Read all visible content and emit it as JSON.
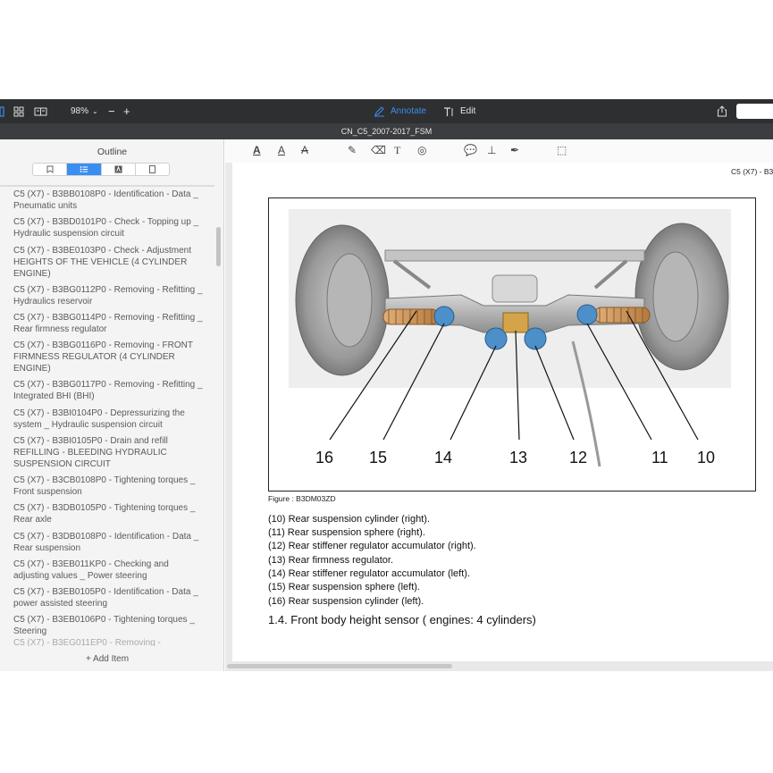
{
  "toolbar": {
    "zoom": "98%",
    "zoom_out": "−",
    "zoom_in": "+",
    "annotate_label": "Annotate",
    "edit_label": "Edit",
    "accent_color": "#3b8ef0"
  },
  "window": {
    "title": "CN_C5_2007-2017_FSM"
  },
  "sidebar": {
    "title": "Outline",
    "tabs": [
      {
        "icon": "bookmark-icon",
        "active": false
      },
      {
        "icon": "outline-list-icon",
        "active": true
      },
      {
        "icon": "annotations-icon",
        "active": false
      },
      {
        "icon": "page-icon",
        "active": false
      }
    ],
    "items": [
      {
        "label": "C5 (X7) - B3BB0108P0 - Identification - Data _ Pneumatic units"
      },
      {
        "label": "C5 (X7) - B3BD0101P0 - Check - Topping up _ Hydraulic suspension circuit"
      },
      {
        "label": "C5 (X7) - B3BE0103P0 - Check - Adjustment HEIGHTS OF THE VEHICLE (4 CYLINDER ENGINE)"
      },
      {
        "label": "C5 (X7) - B3BG0112P0 - Removing - Refitting _ Hydraulics reservoir"
      },
      {
        "label": "C5 (X7) - B3BG0114P0 - Removing - Refitting _ Rear firmness regulator"
      },
      {
        "label": "C5 (X7) - B3BG0116P0 - Removing - FRONT FIRMNESS REGULATOR (4 CYLINDER ENGINE)"
      },
      {
        "label": "C5 (X7) - B3BG0117P0 - Removing - Refitting _ Integrated BHI (BHI)"
      },
      {
        "label": "C5 (X7) - B3BI0104P0 - Depressurizing the system _ Hydraulic suspension circuit"
      },
      {
        "label": "C5 (X7) - B3BI0105P0 - Drain and refill REFILLING - BLEEDING HYDRAULIC SUSPENSION CIRCUIT"
      },
      {
        "label": "C5 (X7) - B3CB0108P0 - Tightening torques _ Front suspension"
      },
      {
        "label": "C5 (X7) - B3DB0105P0 - Tightening torques _ Rear axle"
      },
      {
        "label": "C5 (X7) - B3DB0108P0 - Identification - Data _ Rear suspension"
      },
      {
        "label": "C5 (X7) - B3EB011KP0 - Checking and adjusting values _ Power steering"
      },
      {
        "label": "C5 (X7) - B3EB0105P0 - Identification - Data _ power assisted steering"
      },
      {
        "label": "C5 (X7) - B3EB0106P0 - Tightening torques _ Steering"
      },
      {
        "label": "C5 (X7) - B3EG011EP0 - Removing -"
      }
    ],
    "add_item": "+ Add Item"
  },
  "document": {
    "page_header": "C5 (X7) - B3",
    "figure_callouts": [
      "16",
      "15",
      "14",
      "13",
      "12",
      "11",
      "10"
    ],
    "figure_caption": "Figure : B3DM03ZD",
    "legend": [
      "(10) Rear suspension cylinder (right).",
      "(11) Rear suspension sphere (right).",
      "(12) Rear stiffener regulator accumulator (right).",
      "(13) Rear firmness regulator.",
      "(14) Rear stiffener regulator accumulator (left).",
      "(15) Rear suspension sphere (left).",
      "(16) Rear suspension cylinder (left)."
    ],
    "section_heading": "1.4. Front body height sensor ( engines: 4 cylinders)"
  }
}
